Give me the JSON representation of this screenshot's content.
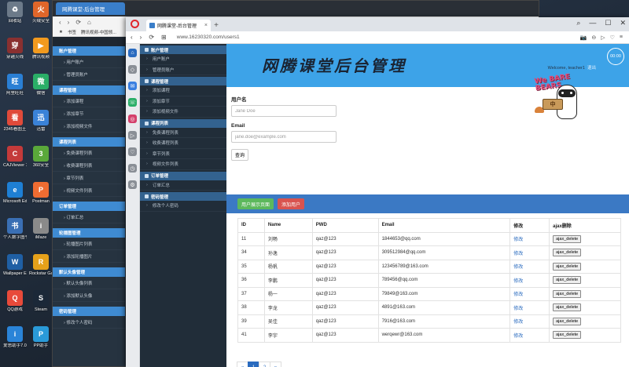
{
  "desktop": {
    "icons": [
      {
        "label": "回收站",
        "color": "#6c7a89",
        "glyph": "♻"
      },
      {
        "label": "火绒安全",
        "color": "#e0662a",
        "glyph": "火"
      },
      {
        "label": "穿越火线",
        "color": "#8a3030",
        "glyph": "穿"
      },
      {
        "label": "腾讯视频",
        "color": "#f29a1e",
        "glyph": "▶"
      },
      {
        "label": "阿里旺旺",
        "color": "#2a7fd4",
        "glyph": "旺"
      },
      {
        "label": "微信",
        "color": "#2aae67",
        "glyph": "微"
      },
      {
        "label": "2345看图王",
        "color": "#e04a3a",
        "glyph": "看"
      },
      {
        "label": "迅雷",
        "color": "#3a82d8",
        "glyph": "迅"
      },
      {
        "label": "CAJViewer 7.3",
        "color": "#c43a3a",
        "glyph": "C"
      },
      {
        "label": "360安全",
        "color": "#5aa83a",
        "glyph": "3"
      },
      {
        "label": "Microsoft Edge",
        "color": "#1e7fd4",
        "glyph": "e"
      },
      {
        "label": "Postman",
        "color": "#ef6c32",
        "glyph": "P"
      },
      {
        "label": "个人数字图书馆2.1",
        "color": "#3a6fb4",
        "glyph": "书"
      },
      {
        "label": "iMaze",
        "color": "#8a8a8a",
        "glyph": "i"
      },
      {
        "label": "Wallpaper Engine",
        "color": "#1f5fa4",
        "glyph": "W"
      },
      {
        "label": "Rockstar Games",
        "color": "#e6a11a",
        "glyph": "R"
      },
      {
        "label": "QQ游戏",
        "color": "#e84a3a",
        "glyph": "Q"
      },
      {
        "label": "Steam",
        "color": "#1b2838",
        "glyph": "S"
      },
      {
        "label": "爱思助手7.0",
        "color": "#2a84d8",
        "glyph": "i"
      },
      {
        "label": "PP助手",
        "color": "#2a9ad8",
        "glyph": "P"
      }
    ]
  },
  "back_browser": {
    "tab_title": "网腾课堂-后台管理",
    "bookmarks": [
      "书签",
      "腾讯视频-中国领..."
    ],
    "sidebar": [
      {
        "type": "head",
        "label": "账户管理"
      },
      {
        "type": "item",
        "label": "用户账户"
      },
      {
        "type": "item",
        "label": "管理员账户"
      },
      {
        "type": "head",
        "label": "课程管理"
      },
      {
        "type": "item",
        "label": "添加课程"
      },
      {
        "type": "item",
        "label": "添加章节"
      },
      {
        "type": "item",
        "label": "添加视频文件"
      },
      {
        "type": "head",
        "label": "课程列表"
      },
      {
        "type": "item",
        "label": "免费课程列表"
      },
      {
        "type": "item",
        "label": "收费课程列表"
      },
      {
        "type": "item",
        "label": "章节列表"
      },
      {
        "type": "item",
        "label": "视频文件列表"
      },
      {
        "type": "head",
        "label": "订单管理"
      },
      {
        "type": "item",
        "label": "订单汇总"
      },
      {
        "type": "head",
        "label": "轮播图管理"
      },
      {
        "type": "item",
        "label": "轮播图片列表"
      },
      {
        "type": "item",
        "label": "添加轮播图片"
      },
      {
        "type": "head",
        "label": "默认头像管理"
      },
      {
        "type": "item",
        "label": "默认头像列表"
      },
      {
        "type": "item",
        "label": "添加默认头像"
      },
      {
        "type": "head",
        "label": "密码管理"
      },
      {
        "type": "item",
        "label": "修改个人密码"
      }
    ]
  },
  "browser": {
    "tab_title": "网腾课堂-后台管理",
    "url": "www.16230320.com/users1",
    "new_tab": "+",
    "nav": {
      "back": "‹",
      "forward": "›",
      "reload": "⟳",
      "grid": "⊞"
    },
    "window_controls": {
      "minimize": "—",
      "maximize": "☐",
      "close": "✕"
    },
    "addr_icons": [
      "📷",
      "⊖",
      "▷",
      "♡",
      "≡"
    ]
  },
  "sidebar": {
    "sections": [
      {
        "title": "账户管理",
        "items": [
          "用户账户",
          "管理员账户"
        ]
      },
      {
        "title": "课程管理",
        "items": [
          "添加课程",
          "添加章节",
          "添加视频文件"
        ]
      },
      {
        "title": "课程列表",
        "items": [
          "免费课程列表",
          "收费课程列表",
          "章节列表",
          "视频文件列表"
        ]
      },
      {
        "title": "订单管理",
        "items": [
          "订单汇总"
        ]
      },
      {
        "title": "密码管理",
        "items": [
          "修改个人密码"
        ]
      }
    ]
  },
  "header": {
    "site_title": "网腾课堂后台管理",
    "welcome_prefix": "Welcome,",
    "username": "teacher1",
    "logout": "退出",
    "clock": "00:00",
    "mascot_text": "We BARE BEARS",
    "sign_text": "中"
  },
  "search_form": {
    "username_label": "用户名",
    "username_placeholder": "Jane Doe",
    "email_label": "Email",
    "email_placeholder": "jane.doe@example.com",
    "submit_label": "查询"
  },
  "actions": {
    "show_all": "用户展示页面",
    "add_user": "添加用户"
  },
  "table": {
    "headers": [
      "ID",
      "Name",
      "PWD",
      "Email",
      "修改",
      "ajax删除"
    ],
    "rows": [
      {
        "id": "11",
        "name": "刘畅",
        "pwd": "qaz@123",
        "email": "1844653@qq.com",
        "edit": "修改",
        "del": "ajax_delete"
      },
      {
        "id": "34",
        "name": "孙逸",
        "pwd": "qaz@123",
        "email": "309512984@qq.com",
        "edit": "修改",
        "del": "ajax_delete"
      },
      {
        "id": "35",
        "name": "杨帆",
        "pwd": "qaz@123",
        "email": "123456789@163.com",
        "edit": "修改",
        "del": "ajax_delete"
      },
      {
        "id": "36",
        "name": "李鹏",
        "pwd": "qaz@123",
        "email": "789456@qq.com",
        "edit": "修改",
        "del": "ajax_delete"
      },
      {
        "id": "37",
        "name": "杨一",
        "pwd": "qaz@123",
        "email": "79849@163.com",
        "edit": "修改",
        "del": "ajax_delete"
      },
      {
        "id": "38",
        "name": "李龙",
        "pwd": "qaz@123",
        "email": "4891@163.com",
        "edit": "修改",
        "del": "ajax_delete"
      },
      {
        "id": "39",
        "name": "吴佳",
        "pwd": "qaz@123",
        "email": "7916@163.com",
        "edit": "修改",
        "del": "ajax_delete"
      },
      {
        "id": "41",
        "name": "李宇",
        "pwd": "qaz@123",
        "email": "werqewr@163.com",
        "edit": "修改",
        "del": "ajax_delete"
      }
    ]
  },
  "pagination": {
    "prev": "«",
    "pages": [
      "1",
      "2"
    ],
    "current": "1",
    "next": "»"
  }
}
